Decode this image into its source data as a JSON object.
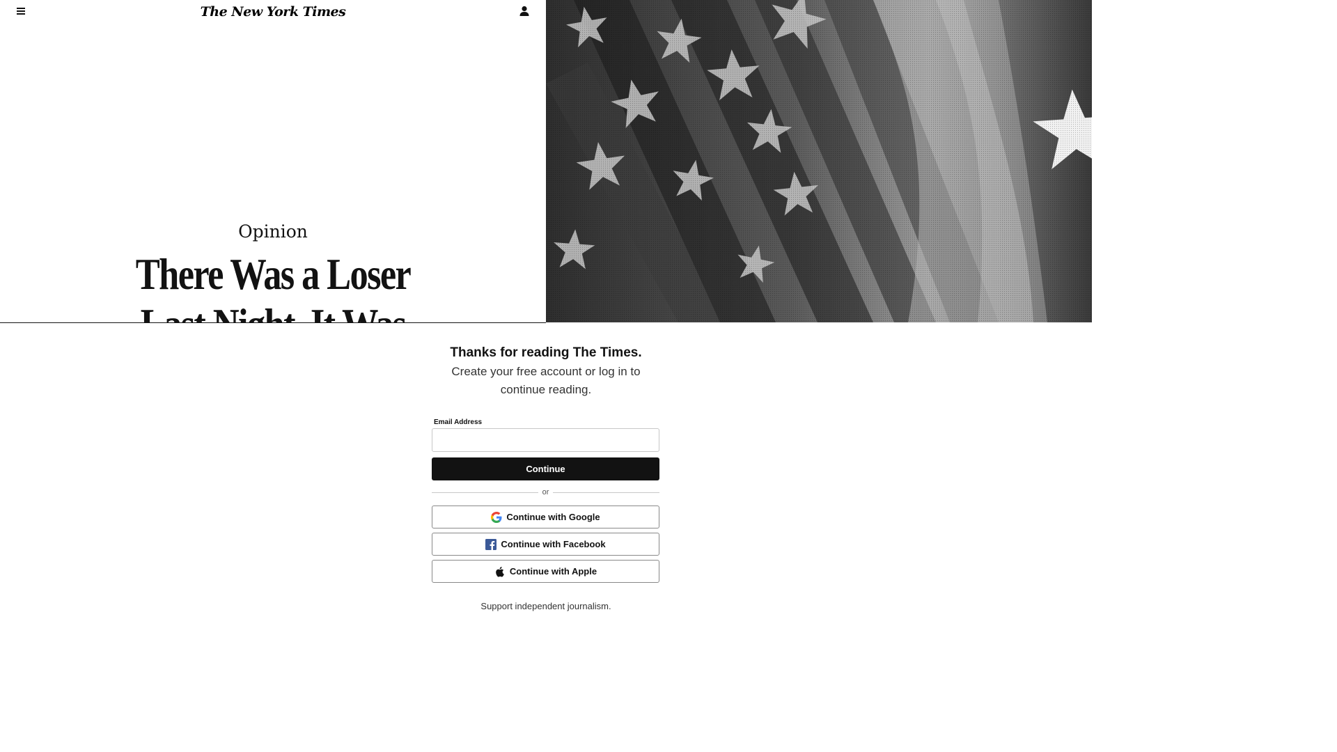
{
  "header": {
    "masthead": "The New York Times"
  },
  "article": {
    "section": "Opinion",
    "headline": "There Was a Loser Last Night. It Was America."
  },
  "image": {
    "description_icon": "american-flag-photo"
  },
  "regiwall": {
    "title": "Thanks for reading The Times.",
    "subtitle": "Create your free account or log in to continue reading.",
    "email_label": "Email Address",
    "email_value": "",
    "email_placeholder": "",
    "continue_label": "Continue",
    "or_text": "or",
    "google_label": "Continue with Google",
    "facebook_label": "Continue with Facebook",
    "apple_label": "Continue with Apple",
    "support_text": "Support independent journalism."
  },
  "colors": {
    "primary": "#121212",
    "background": "#ffffff",
    "facebook": "#3b5998"
  }
}
